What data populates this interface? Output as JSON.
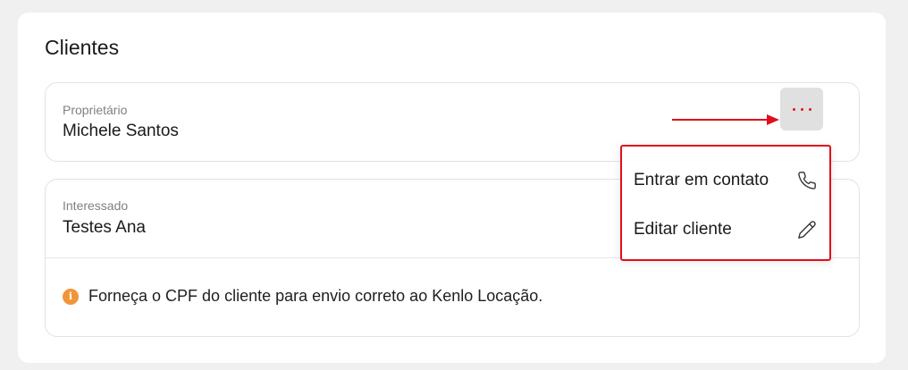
{
  "section": {
    "title": "Clientes"
  },
  "owner": {
    "role_label": "Proprietário",
    "name": "Michele Santos"
  },
  "interested": {
    "role_label": "Interessado",
    "name": "Testes Ana",
    "notice": "Forneça o CPF do cliente para envio correto ao Kenlo Locação.",
    "notice_icon": "info-icon",
    "notice_icon_glyph": "i"
  },
  "menu": {
    "items": [
      {
        "label": "Entrar em contato",
        "icon": "phone-icon"
      },
      {
        "label": "Editar cliente",
        "icon": "pencil-icon"
      }
    ]
  },
  "colors": {
    "highlight": "#e0101a",
    "notice_icon": "#f0963a",
    "more_button_bg": "#e0e0e0"
  }
}
